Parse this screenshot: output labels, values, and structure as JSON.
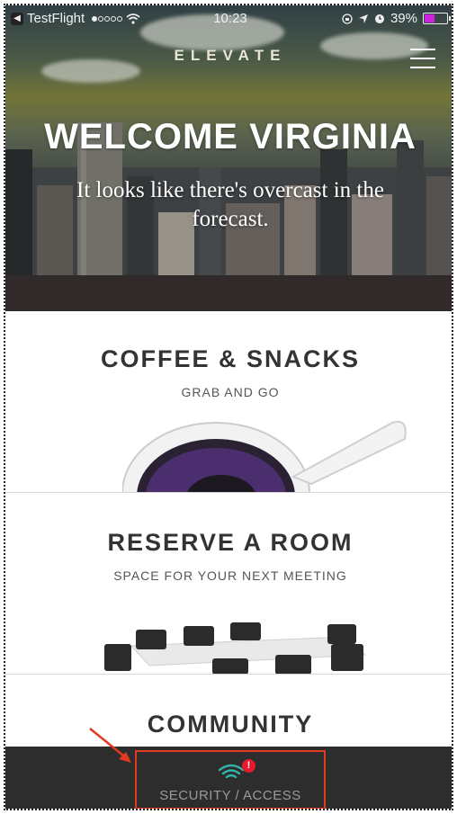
{
  "status_bar": {
    "back_app": "TestFlight",
    "time": "10:23",
    "battery": "39%",
    "battery_color": "#d020e0"
  },
  "header": {
    "brand": "ELEVATE",
    "menu_icon": "hamburger-menu-icon"
  },
  "hero": {
    "greeting": "WELCOME VIRGINIA",
    "weather_message": "It looks like there's overcast in the forecast."
  },
  "sections": [
    {
      "title": "COFFEE & SNACKS",
      "subtitle": "GRAB AND GO"
    },
    {
      "title": "RESERVE A ROOM",
      "subtitle": "SPACE FOR YOUR NEXT MEETING"
    },
    {
      "title": "COMMUNITY",
      "subtitle": ""
    }
  ],
  "bottom_nav": {
    "security_label": "SECURITY / ACCESS",
    "icon": "wifi-icon",
    "badge": "!",
    "highlight_color": "#e23a20"
  }
}
